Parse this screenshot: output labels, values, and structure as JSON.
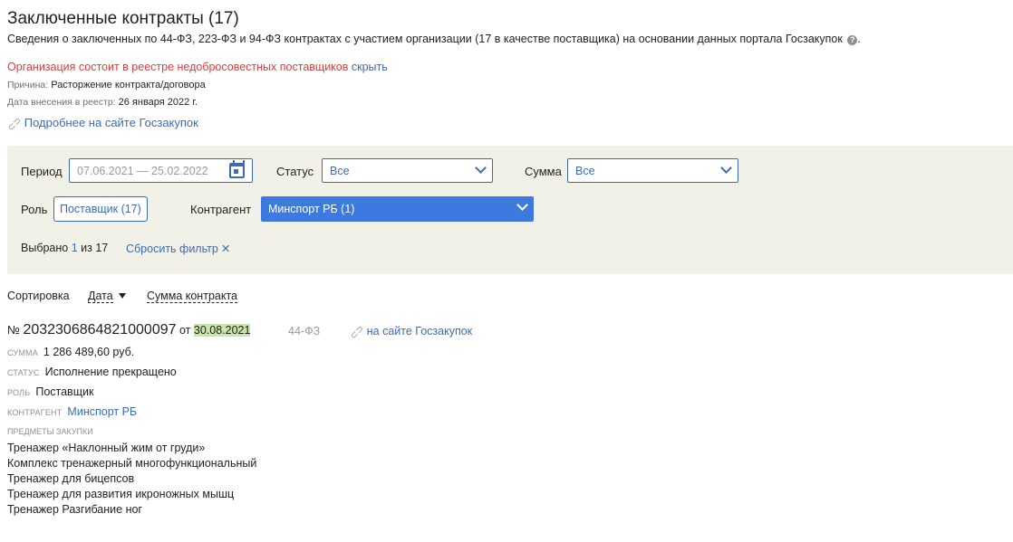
{
  "header": {
    "title": "Заключенные контракты (17)",
    "subtitle": "Сведения о заключенных по 44-ФЗ, 223-ФЗ и 94-ФЗ контрактах с участием организации (17 в качестве поставщика) на основании данных портала Госзакупок",
    "help_icon": "question-circle-icon"
  },
  "warning": {
    "text": "Организация состоит в реестре недобросовестных поставщиков",
    "hide_link": "скрыть",
    "reason_label": "Причина:",
    "reason_value": "Расторжение контракта/договора",
    "date_label": "Дата внесения в реестр:",
    "date_value": "26 января 2022 г.",
    "more_link": "Подробнее на сайте Госзакупок",
    "color": "#e53935"
  },
  "filters": {
    "period_label": "Период",
    "period_placeholder": "07.06.2021 — 25.02.2022",
    "status_label": "Статус",
    "status_value": "Все",
    "sum_label": "Сумма",
    "sum_value": "Все",
    "role_label": "Роль",
    "role_value": "Поставщик (17)",
    "counterparty_label": "Контрагент",
    "counterparty_value": "Минспорт РБ (1)",
    "selected_prefix": "Выбрано",
    "selected_num": "1",
    "selected_suffix": "из 17",
    "reset_label": "Сбросить фильтр",
    "reset_icon": "✕",
    "panel_color": "#f1f1e8",
    "accent_color": "#3d6bb3"
  },
  "sort": {
    "label": "Сортировка",
    "options": [
      "Дата",
      "Сумма контракта"
    ]
  },
  "contract": {
    "num_sign": "№",
    "number": "2032306864821000097",
    "from_word": "от",
    "date": "30.08.2021",
    "law": "44-ФЗ",
    "site_link": "на сайте Госзакупок",
    "sum_caption": "СУММА",
    "sum_value": "1 286 489,60 руб.",
    "status_caption": "СТАТУС",
    "status_value": "Исполнение прекращено",
    "role_caption": "РОЛЬ",
    "role_value": "Поставщик",
    "counterparty_caption": "КОНТРАГЕНТ",
    "counterparty_value": "Минспорт РБ",
    "items_caption": "ПРЕДМЕТЫ ЗАКУПКИ",
    "items": [
      "Тренажер «Наклонный жим от груди»",
      "Комплекс тренажерный многофункциональный",
      "Тренажер для бицепсов",
      "Тренажер для развития икроножных мышц",
      "Тренажер Разгибание ног"
    ]
  }
}
